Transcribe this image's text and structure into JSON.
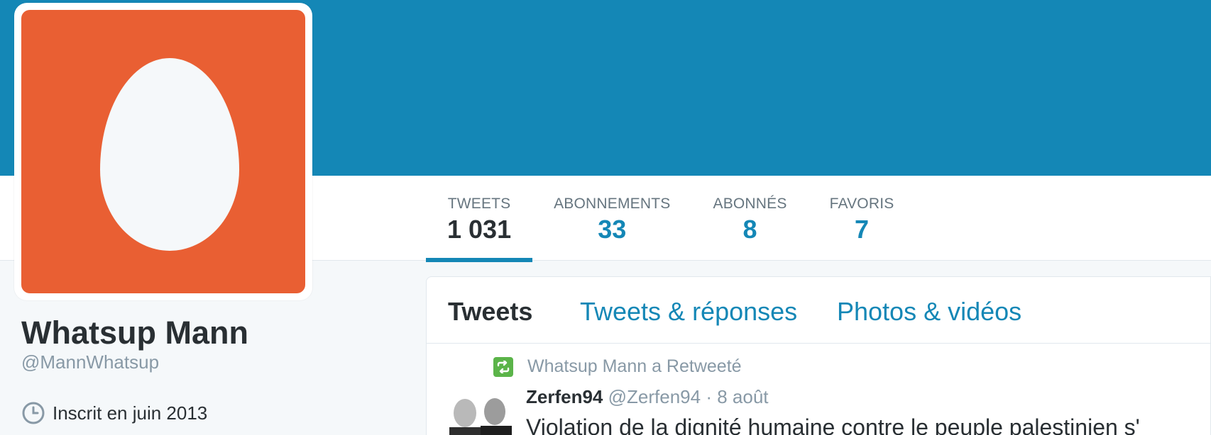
{
  "colors": {
    "brand": "#1487b6",
    "avatar_background": "#e95f33",
    "retweet_green": "#5bb449",
    "muted_text": "#8899a6"
  },
  "profile": {
    "name": "Whatsup Mann",
    "handle": "@MannWhatsup",
    "joined": "Inscrit en juin 2013",
    "joined_icon": "clock-icon",
    "avatar_icon": "default-egg-avatar"
  },
  "stats": [
    {
      "label": "TWEETS",
      "value": "1 031",
      "active": true
    },
    {
      "label": "ABONNEMENTS",
      "value": "33",
      "active": false
    },
    {
      "label": "ABONNÉS",
      "value": "8",
      "active": false
    },
    {
      "label": "FAVORIS",
      "value": "7",
      "active": false
    }
  ],
  "timeline": {
    "tabs": [
      {
        "label": "Tweets",
        "active": true
      },
      {
        "label": "Tweets & réponses",
        "active": false
      },
      {
        "label": "Photos & vidéos",
        "active": false
      }
    ],
    "tweet": {
      "retweet_context": "Whatsup Mann a Retweeté",
      "retweet_icon": "retweet-icon",
      "author": "Zerfen94",
      "handle": "@Zerfen94",
      "separator": "·",
      "date": "8 août",
      "text": "Violation de la dignité humaine contre le peuple palestinien s'"
    }
  }
}
